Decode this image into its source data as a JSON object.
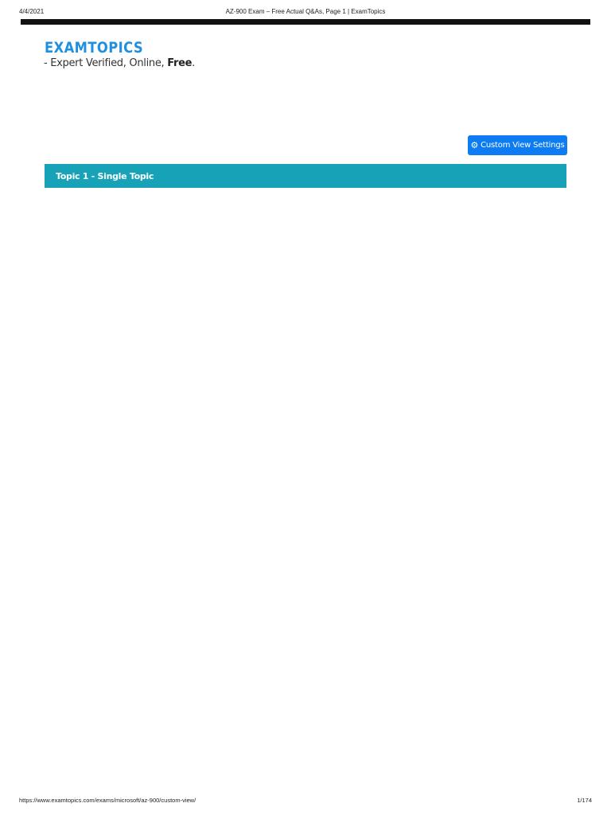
{
  "print_header": {
    "date": "4/4/2021",
    "title": "AZ-900 Exam – Free Actual Q&As, Page 1 | ExamTopics"
  },
  "logo": {
    "text": "EXAMTOPICS",
    "color": "#1f8fe0"
  },
  "tagline": {
    "prefix": "- Expert Verified, Online, ",
    "bold": "Free",
    "suffix": "."
  },
  "custom_view_button": {
    "icon": "gear-icon",
    "label": "Custom View Settings",
    "color": "#0d7bf2"
  },
  "topic_bar": {
    "label": "Topic 1 - Single Topic",
    "color": "#17a2b8"
  },
  "print_footer": {
    "url": "https://www.examtopics.com/exams/microsoft/az-900/custom-view/",
    "page": "1/174"
  }
}
